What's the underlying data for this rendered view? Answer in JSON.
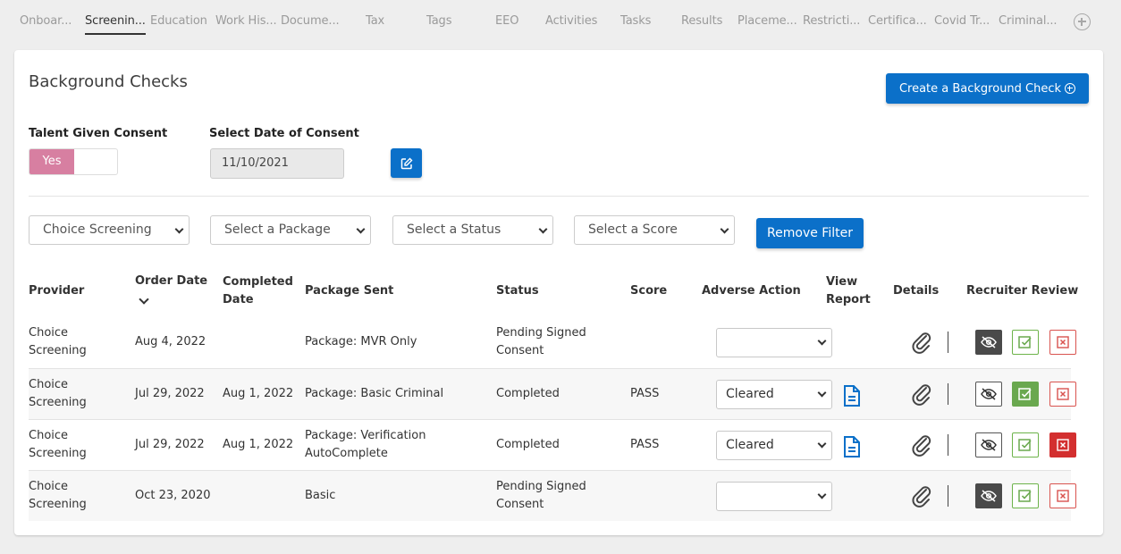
{
  "tabs": [
    {
      "label": "Onboar..."
    },
    {
      "label": "Screenin..."
    },
    {
      "label": "Education"
    },
    {
      "label": "Work His..."
    },
    {
      "label": "Docume..."
    },
    {
      "label": "Tax"
    },
    {
      "label": "Tags"
    },
    {
      "label": "EEO"
    },
    {
      "label": "Activities"
    },
    {
      "label": "Tasks"
    },
    {
      "label": "Results"
    },
    {
      "label": "Placeme..."
    },
    {
      "label": "Restricti..."
    },
    {
      "label": "Certifica..."
    },
    {
      "label": "Covid Tr..."
    },
    {
      "label": "Criminal..."
    }
  ],
  "active_tab": "Screenin...",
  "card": {
    "title": "Background Checks",
    "create_button": "Create a Background Check"
  },
  "consent": {
    "label": "Talent Given Consent",
    "toggle_value": "Yes",
    "date_label": "Select Date of Consent",
    "date_value": "11/10/2021"
  },
  "filters": {
    "provider": "Choice Screening",
    "package": "Select a Package",
    "status": "Select a Status",
    "score": "Select a Score",
    "remove_button": "Remove Filter"
  },
  "table": {
    "headers": {
      "provider": "Provider",
      "order_date": "Order Date",
      "completed_date_1": "Completed",
      "completed_date_2": "Date",
      "package_sent": "Package Sent",
      "status": "Status",
      "score": "Score",
      "adverse_action": "Adverse Action",
      "view_report_1": "View",
      "view_report_2": "Report",
      "details": "Details",
      "recruiter_review": "Recruiter Review"
    },
    "rows": [
      {
        "provider_1": "Choice",
        "provider_2": "Screening",
        "order_date": "Aug 4, 2022",
        "completed_date": "",
        "package_1": "Package: MVR Only",
        "package_2": "",
        "status_1": "Pending Signed",
        "status_2": "Consent",
        "score": "",
        "adverse_action": ""
      },
      {
        "provider_1": "Choice",
        "provider_2": "Screening",
        "order_date": "Jul 29, 2022",
        "completed_date": "Aug 1, 2022",
        "package_1": "Package: Basic Criminal",
        "package_2": "",
        "status_1": "Completed",
        "status_2": "",
        "score": "PASS",
        "adverse_action": "Cleared"
      },
      {
        "provider_1": "Choice",
        "provider_2": "Screening",
        "order_date": "Jul 29, 2022",
        "completed_date": "Aug 1, 2022",
        "package_1": "Package: Verification",
        "package_2": "AutoComplete",
        "status_1": "Completed",
        "status_2": "",
        "score": "PASS",
        "adverse_action": "Cleared"
      },
      {
        "provider_1": "Choice",
        "provider_2": "Screening",
        "order_date": "Oct 23, 2020",
        "completed_date": "",
        "package_1": "Basic",
        "package_2": "",
        "status_1": "Pending Signed",
        "status_2": "Consent",
        "score": "",
        "adverse_action": ""
      }
    ]
  },
  "colors": {
    "primary": "#0b70c9",
    "toggle_yes": "#d77fa1",
    "approve_green": "#6aa84f",
    "reject_red": "#d32f2f"
  },
  "icons": [
    "add-tab-icon",
    "plus-circle-icon",
    "edit-icon",
    "chevron-down-icon",
    "document-icon",
    "paperclip-icon",
    "eye-slash-icon",
    "check-square-icon",
    "x-square-icon"
  ]
}
